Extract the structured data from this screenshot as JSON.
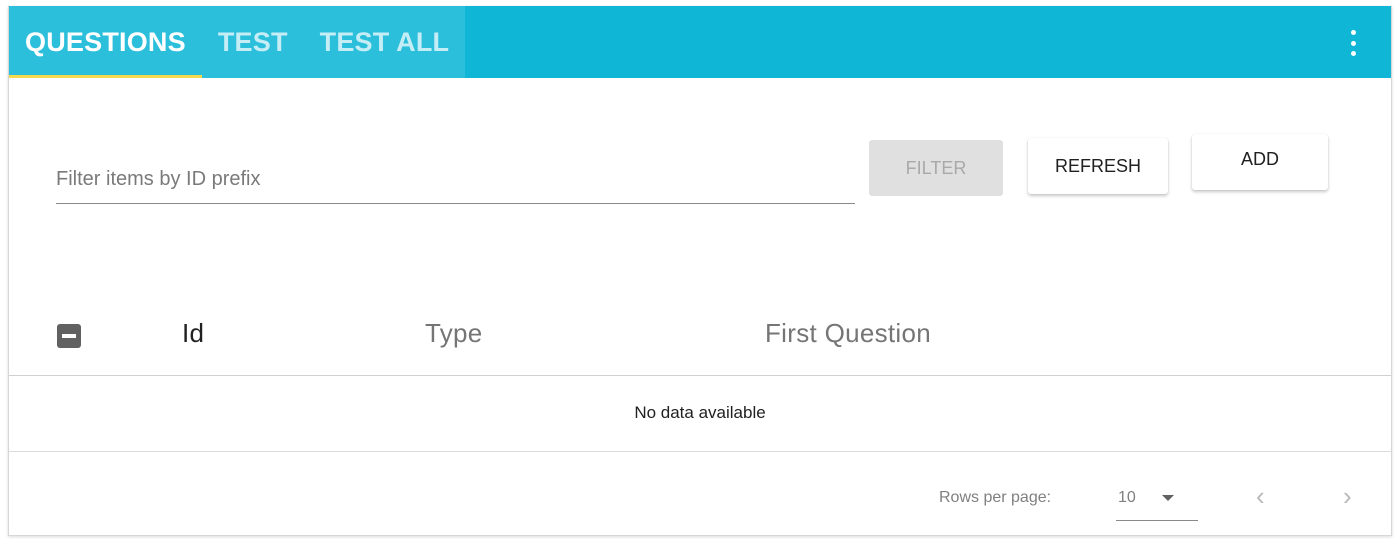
{
  "tabs": [
    {
      "label": "QUESTIONS",
      "active": true
    },
    {
      "label": "TEST",
      "active": false
    },
    {
      "label": "TEST ALL",
      "active": false
    }
  ],
  "menu_icon": "more-vert-icon",
  "filter": {
    "placeholder": "Filter items by ID prefix",
    "value": ""
  },
  "buttons": {
    "filter_label": "FILTER",
    "refresh_label": "REFRESH",
    "add_label": "ADD"
  },
  "table": {
    "columns": [
      "Id",
      "Type",
      "First Question"
    ],
    "empty_message": "No data available"
  },
  "pagination": {
    "rows_per_page_label": "Rows per page:",
    "rows_per_page_value": "10",
    "prev_icon": "chevron-left-icon",
    "next_icon": "chevron-right-icon"
  },
  "colors": {
    "tabbar": "#0fb6d6",
    "tab_indicator": "#f5d94e",
    "checkbox": "#616161"
  }
}
